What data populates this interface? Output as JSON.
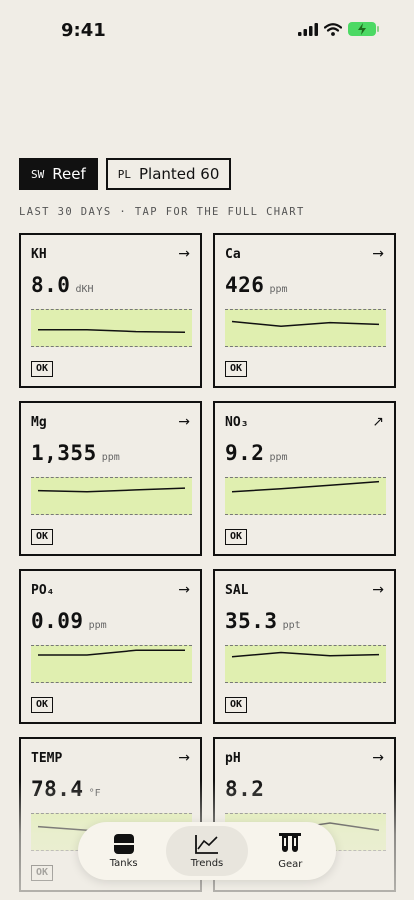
{
  "status_bar": {
    "time": "9:41"
  },
  "tanks": [
    {
      "code": "SW",
      "name": "Reef",
      "active": true
    },
    {
      "code": "PL",
      "name": "Planted 60",
      "active": false
    }
  ],
  "caption": "LAST 30 DAYS · TAP FOR THE FULL CHART",
  "cards": [
    {
      "label": "KH",
      "value": "8.0",
      "unit": "dKH",
      "arrow": "→",
      "status": "OK",
      "trend": [
        0.55,
        0.55,
        0.6,
        0.62
      ]
    },
    {
      "label": "Ca",
      "value": "426",
      "unit": "ppm",
      "arrow": "→",
      "status": "OK",
      "trend": [
        0.32,
        0.45,
        0.35,
        0.4
      ]
    },
    {
      "label": "Mg",
      "value": "1,355",
      "unit": "ppm",
      "arrow": "→",
      "status": "OK",
      "trend": [
        0.35,
        0.38,
        0.33,
        0.28
      ]
    },
    {
      "label": "NO₃",
      "value": "9.2",
      "unit": "ppm",
      "arrow": "↗",
      "status": "OK",
      "trend": [
        0.38,
        0.3,
        0.2,
        0.1
      ]
    },
    {
      "label": "PO₄",
      "value": "0.09",
      "unit": "ppm",
      "arrow": "→",
      "status": "OK",
      "trend": [
        0.25,
        0.25,
        0.12,
        0.12
      ]
    },
    {
      "label": "SAL",
      "value": "35.3",
      "unit": "ppt",
      "arrow": "→",
      "status": "OK",
      "trend": [
        0.3,
        0.18,
        0.27,
        0.24
      ]
    },
    {
      "label": "TEMP",
      "value": "78.4",
      "unit": "°F",
      "arrow": "→",
      "status": "OK",
      "trend": [
        0.35,
        0.45,
        0.45,
        0.5
      ]
    },
    {
      "label": "pH",
      "value": "8.2",
      "unit": "",
      "arrow": "→",
      "status": "",
      "trend": [
        0.55,
        0.45,
        0.25,
        0.45
      ]
    }
  ],
  "tabbar": [
    {
      "label": "Tanks",
      "icon": "tanks-icon",
      "active": false
    },
    {
      "label": "Trends",
      "icon": "trends-icon",
      "active": true
    },
    {
      "label": "Gear",
      "icon": "gear-icon",
      "active": false
    }
  ]
}
